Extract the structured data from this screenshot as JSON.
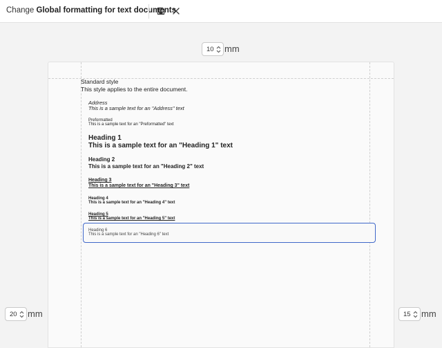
{
  "header": {
    "title_prefix": "Change",
    "title_bold": "Global formatting for text documents",
    "save_icon": "save-icon",
    "close_icon": "close-icon"
  },
  "margins": {
    "top": {
      "value": "10",
      "unit": "mm"
    },
    "left": {
      "value": "20",
      "unit": "mm"
    },
    "right": {
      "value": "15",
      "unit": "mm"
    }
  },
  "document": {
    "standard_label": "Standard style",
    "standard_desc": "This style applies to the entire document.",
    "styles": [
      {
        "name": "Address",
        "sample": "This is a sample text for an \"Address\" text"
      },
      {
        "name": "Preformatted",
        "sample": "This is a sample text for an \"Preformatted\" text"
      },
      {
        "name": "Heading 1",
        "sample": "This is a sample text for an \"Heading 1\" text"
      },
      {
        "name": "Heading 2",
        "sample": "This is a sample text for an \"Heading 2\" text"
      },
      {
        "name": "Heading 3",
        "sample": "This is a sample text for an \"Heading 3\" text"
      },
      {
        "name": "Heading 4",
        "sample": "This is a sample text for an \"Heading 4\" text"
      },
      {
        "name": "Heading 5",
        "sample": "This is a sample text for an \"Heading 5\" text"
      },
      {
        "name": "Heading 6",
        "sample": "This is a sample text for an \"Heading 6\" text"
      }
    ]
  },
  "colors": {
    "accent": "#3f67c9",
    "canvas_bg": "#f3f3f3"
  }
}
